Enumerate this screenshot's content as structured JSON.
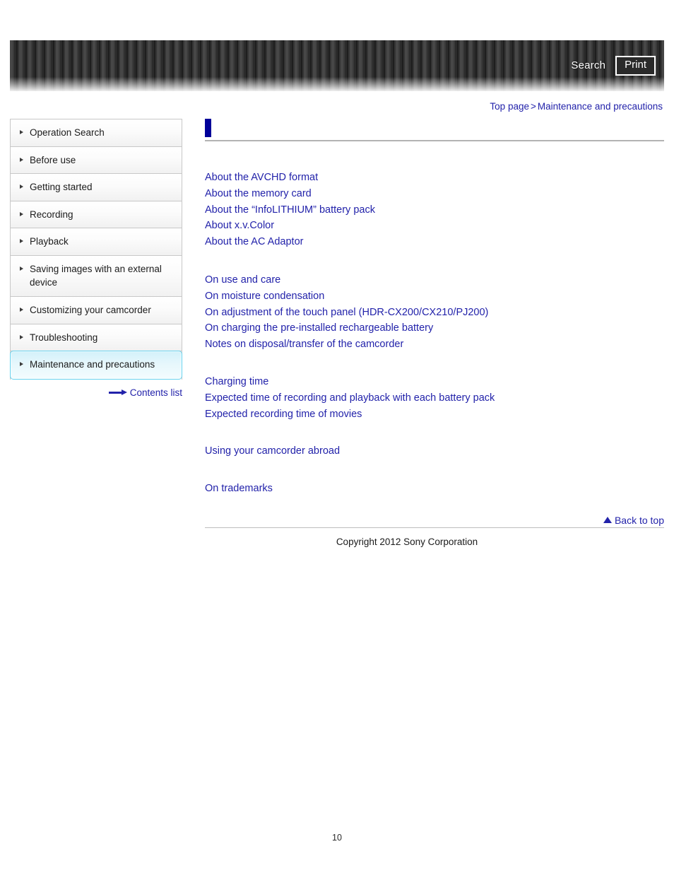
{
  "header": {
    "search_label": "Search",
    "print_label": "Print",
    "banner_color": "#3b3b3b"
  },
  "breadcrumb": {
    "top_page": "Top page",
    "separator": ">",
    "current": "Maintenance and precautions"
  },
  "sidebar": {
    "items": [
      {
        "label": "Operation Search",
        "active": false
      },
      {
        "label": "Before use",
        "active": false
      },
      {
        "label": "Getting started",
        "active": false
      },
      {
        "label": "Recording",
        "active": false
      },
      {
        "label": "Playback",
        "active": false
      },
      {
        "label": "Saving images with an external device",
        "active": false
      },
      {
        "label": "Customizing your camcorder",
        "active": false
      },
      {
        "label": "Troubleshooting",
        "active": false
      },
      {
        "label": "Maintenance and precautions",
        "active": true
      }
    ],
    "contents_list_label": "Contents list",
    "contents_list_icon": "arrow-right-icon",
    "active_color": "#67d3ef"
  },
  "main": {
    "heading_title": "",
    "heading_marker_color": "#000099",
    "link_color": "#2222aa",
    "groups": [
      {
        "id": "group-1",
        "links": [
          "About the AVCHD format",
          "About the memory card",
          "About the “InfoLITHIUM” battery pack",
          "About x.v.Color",
          "About the AC Adaptor"
        ]
      },
      {
        "id": "group-2",
        "links": [
          "On use and care",
          "On moisture condensation",
          "On adjustment of the touch panel (HDR-CX200/CX210/PJ200)",
          "On charging the pre-installed rechargeable battery",
          "Notes on disposal/transfer of the camcorder"
        ]
      },
      {
        "id": "group-3",
        "links": [
          "Charging time",
          "Expected time of recording and playback with each battery pack",
          "Expected recording time of movies"
        ]
      },
      {
        "id": "group-4",
        "links": [
          "Using your camcorder abroad"
        ]
      },
      {
        "id": "group-5",
        "links": [
          "On trademarks"
        ]
      }
    ]
  },
  "footer": {
    "back_to_top_label": "Back to top",
    "back_to_top_icon": "triangle-up-icon",
    "copyright": "Copyright 2012 Sony Corporation"
  },
  "page_number": "10"
}
